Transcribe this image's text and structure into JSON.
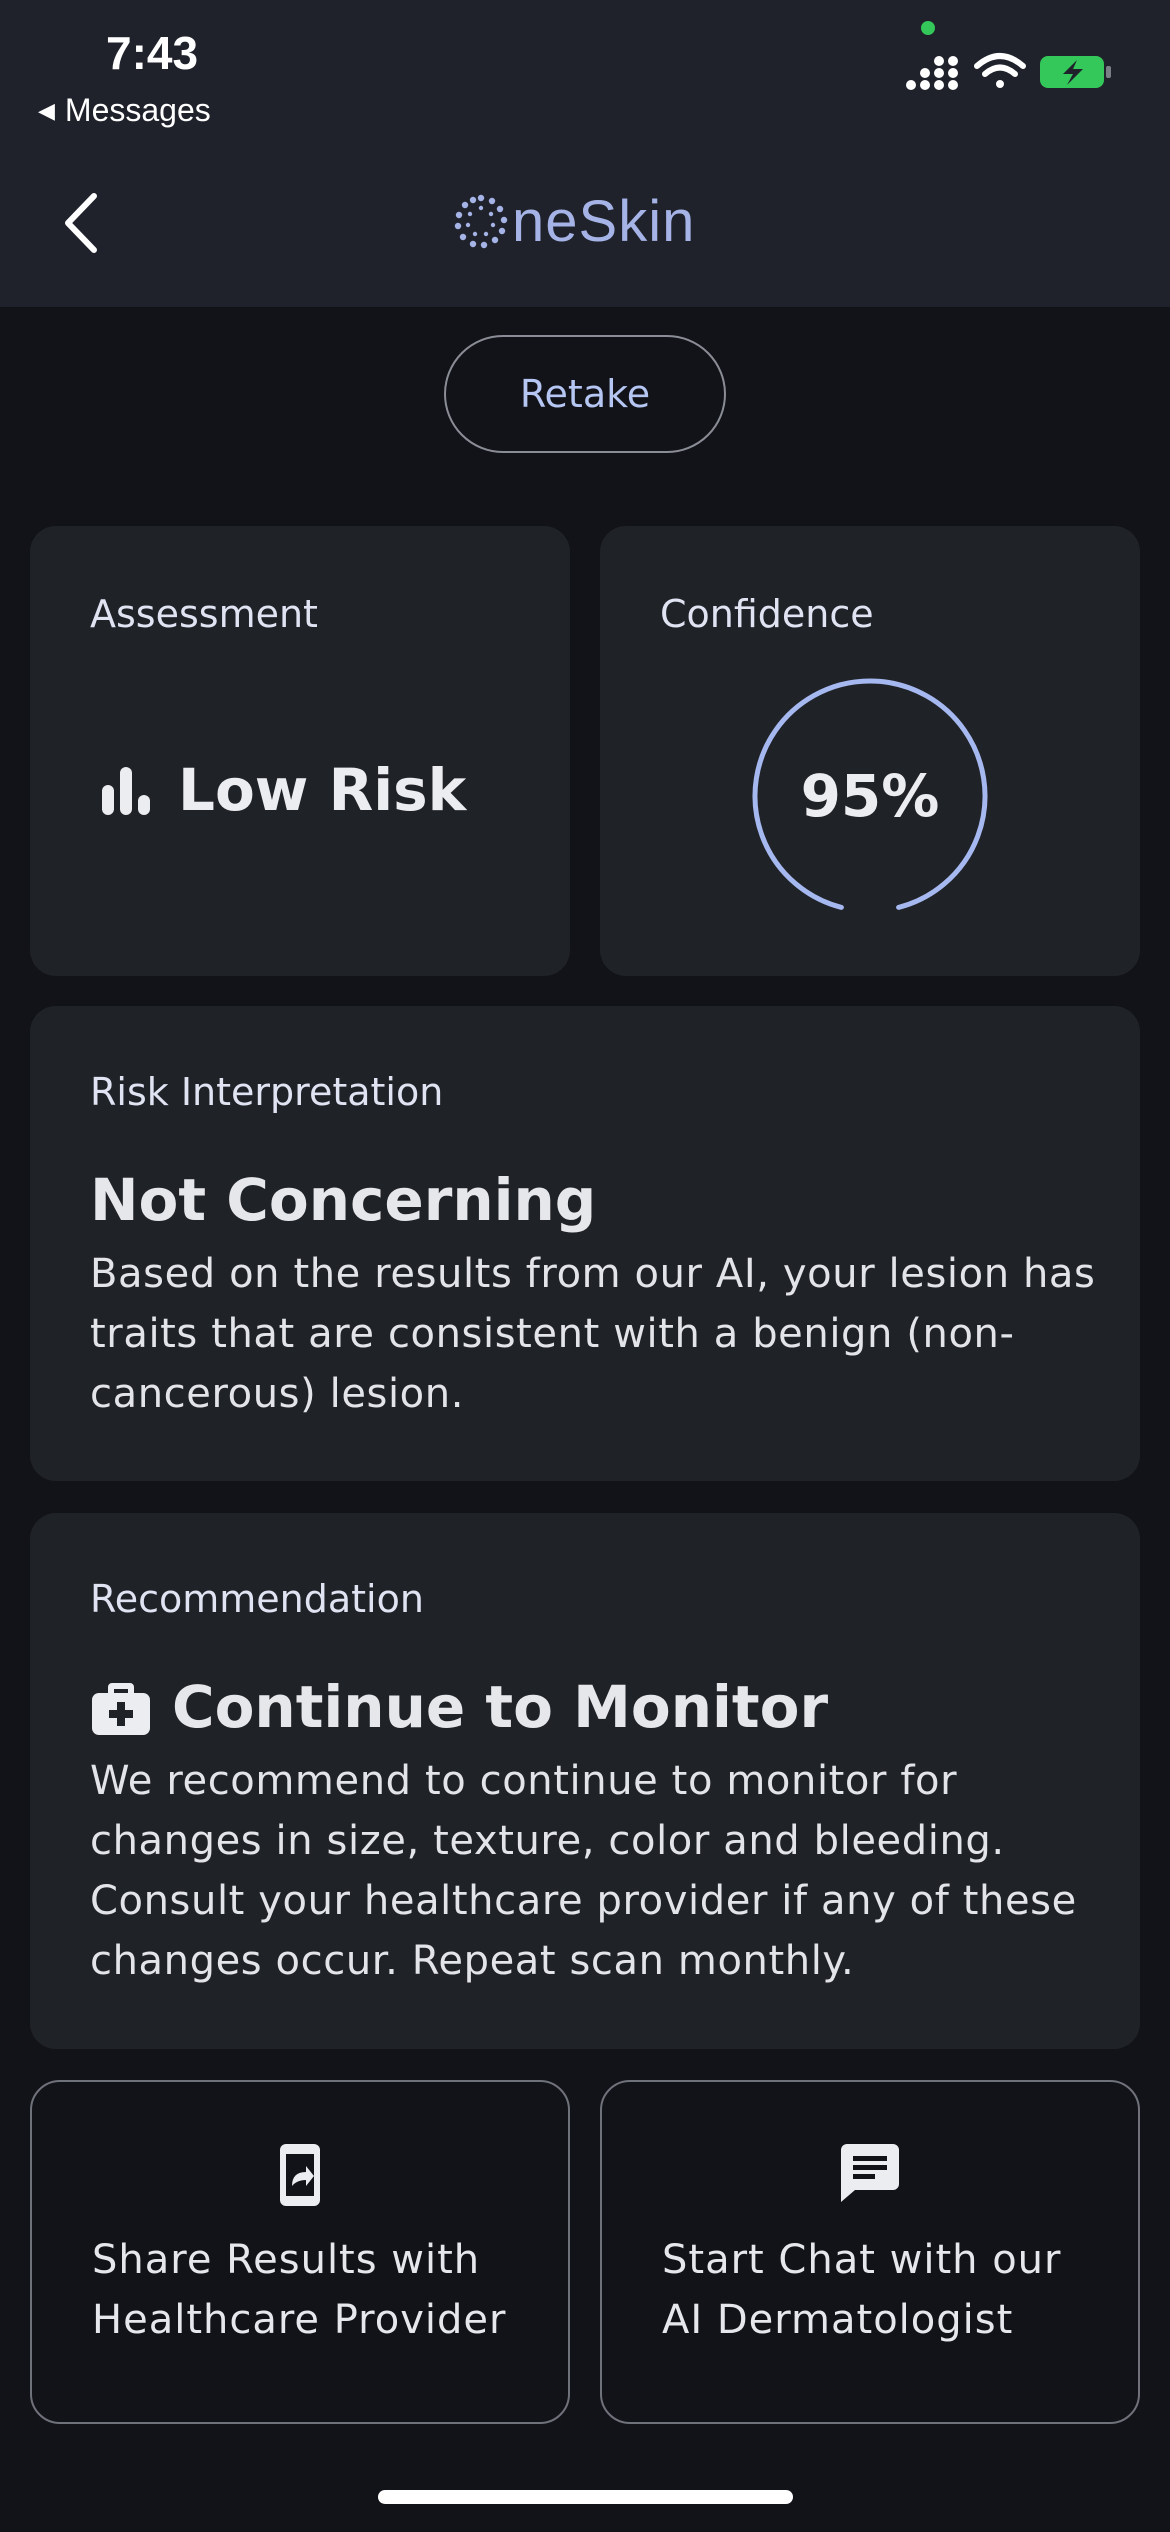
{
  "status_bar": {
    "time": "7:43",
    "back_app": "Messages"
  },
  "nav": {
    "brand": "neSkin"
  },
  "retake_label": "Retake",
  "assessment": {
    "label": "Assessment",
    "value": "Low Risk"
  },
  "confidence": {
    "label": "Confidence",
    "value": "95%",
    "level": 0.95
  },
  "interpretation": {
    "label": "Risk Interpretation",
    "title": "Not Concerning",
    "body": "Based on the results from our AI, your lesion has traits that are consistent with a benign (non-cancerous) lesion."
  },
  "recommendation": {
    "label": "Recommendation",
    "title": "Continue to Monitor",
    "body": "We recommend to continue to monitor for changes in size, texture, color and bleeding. Consult your healthcare provider if any of these changes occur. Repeat scan monthly."
  },
  "actions": {
    "share_line1": "Share Results with",
    "share_line2": "Healthcare Provider",
    "chat_line1": "Start Chat with our",
    "chat_line2": "AI Dermatologist"
  },
  "colors": {
    "accent": "#a6b8f0",
    "battery": "#34c759",
    "background": "#121318",
    "card": "#1f2227"
  }
}
